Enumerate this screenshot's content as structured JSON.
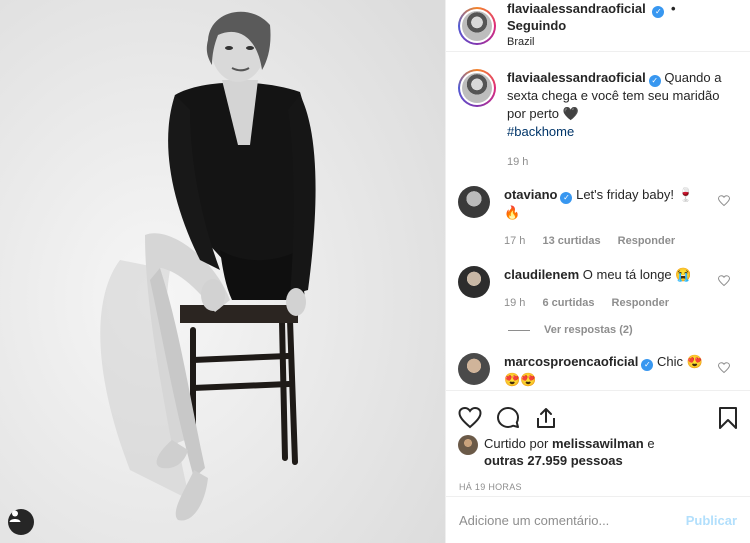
{
  "post": {
    "author": "flaviaalessandraoficial",
    "follow_dot": "•",
    "follow_status": "Seguindo",
    "location": "Brazil",
    "caption_text": "Quando a sexta chega e você tem seu maridão por perto 🖤",
    "hashtag": "#backhome",
    "caption_time": "19 h"
  },
  "comments": [
    {
      "username": "otaviano",
      "verified": true,
      "text": "Let's friday baby! 🍷🔥",
      "time": "17 h",
      "likes": "13 curtidas",
      "reply": "Responder"
    },
    {
      "username": "claudilenem",
      "verified": false,
      "text": "O meu tá longe 😭",
      "time": "19 h",
      "likes": "6 curtidas",
      "reply": "Responder",
      "view_replies": "Ver respostas (2)"
    },
    {
      "username": "marcosproencaoficial",
      "verified": true,
      "text": "Chic 😍 😍😍"
    }
  ],
  "likes": {
    "prefix": "Curtido por",
    "user": "melissawilman",
    "conj": "e",
    "others": "outras 27.959 pessoas"
  },
  "timestamp": "HÁ 19 HORAS",
  "comment_box": {
    "placeholder": "Adicione um comentário...",
    "submit": "Publicar"
  },
  "icons": [
    "heart-icon",
    "comment-icon",
    "share-icon",
    "bookmark-icon",
    "user-tag-icon"
  ],
  "colors": {
    "verified": "#3897f0",
    "hashtag": "#003569",
    "secondary_text": "#8e8e8e",
    "publish_disabled": "#b2dffc"
  }
}
